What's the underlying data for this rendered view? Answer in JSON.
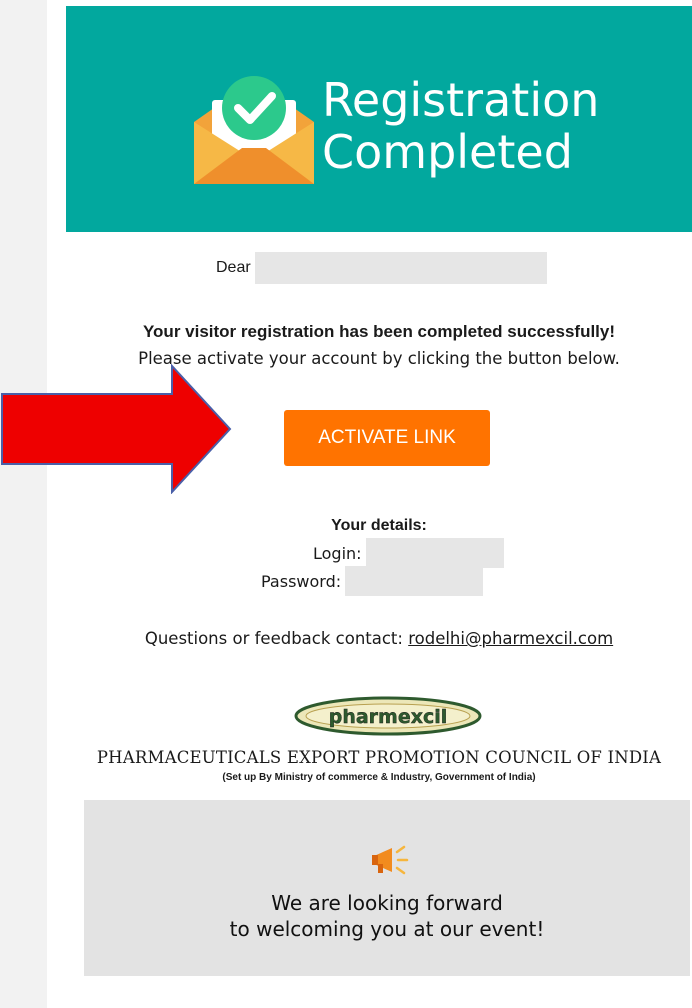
{
  "header": {
    "icon": "envelope-check-icon",
    "title_line1": "Registration",
    "title_line2": "Completed"
  },
  "greeting": {
    "label": "Dear"
  },
  "message": {
    "success": "Your visitor registration has been completed successfully!",
    "instruction": "Please activate your account by clicking the button below."
  },
  "activate_button": {
    "label": "ACTIVATE LINK"
  },
  "details": {
    "title": "Your details:",
    "login_label": "Login:",
    "password_label": "Password:"
  },
  "contact": {
    "prefix": "Questions or feedback contact: ",
    "email": "rodelhi@pharmexcil.com"
  },
  "organization": {
    "logo_text": "pharmexcil",
    "name": "PHARMACEUTICALS EXPORT PROMOTION COUNCIL OF INDIA",
    "subtitle": "(Set up By Ministry of commerce & Industry, Government of India)"
  },
  "footer": {
    "icon": "megaphone-icon",
    "line1": "We are looking forward",
    "line2": "to welcoming you at our event!"
  },
  "annotation": {
    "icon": "red-arrow-icon",
    "color": "#ee0000"
  },
  "colors": {
    "header_bg": "#02a89e",
    "button_bg": "#ff7300",
    "footer_bg": "#e3e3e3"
  }
}
